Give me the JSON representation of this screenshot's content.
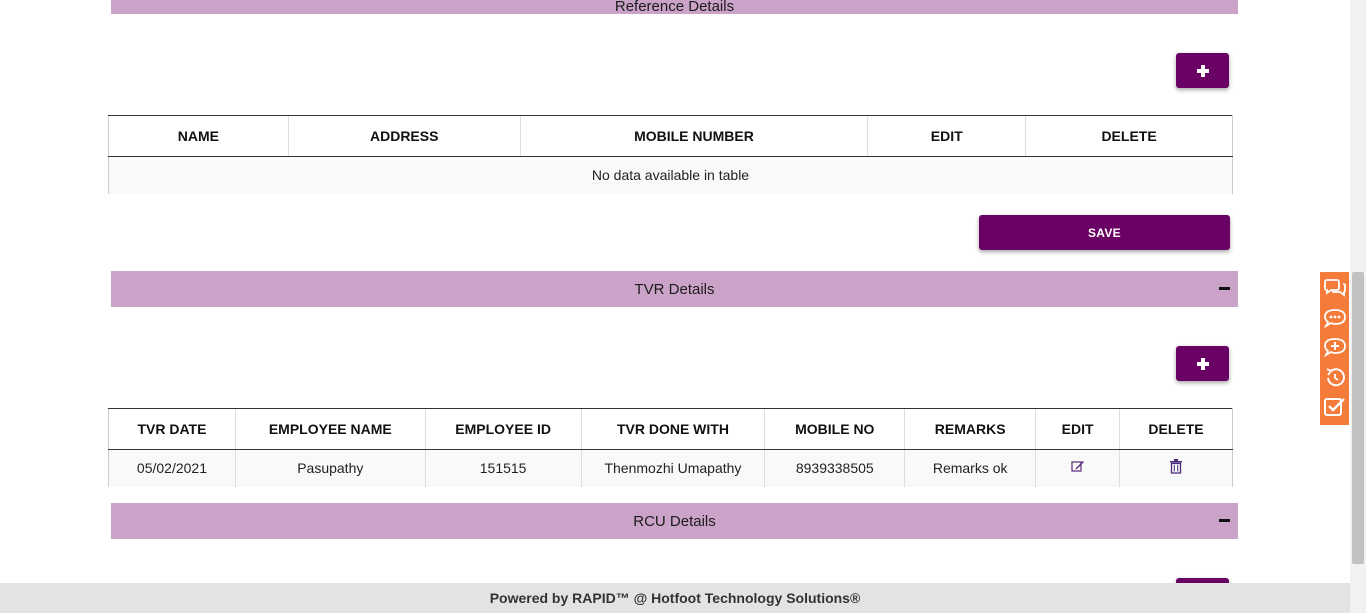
{
  "reference_section": {
    "title": "Reference Details",
    "columns": [
      "NAME",
      "ADDRESS",
      "MOBILE NUMBER",
      "EDIT",
      "DELETE"
    ],
    "empty_message": "No data available in table",
    "save_label": "SAVE"
  },
  "tvr_section": {
    "title": "TVR Details",
    "columns": [
      "TVR DATE",
      "EMPLOYEE NAME",
      "EMPLOYEE ID",
      "TVR DONE WITH",
      "MOBILE NO",
      "REMARKS",
      "EDIT",
      "DELETE"
    ],
    "rows": [
      {
        "tvr_date": "05/02/2021",
        "employee_name": "Pasupathy",
        "employee_id": "151515",
        "tvr_done_with": "Thenmozhi Umapathy",
        "mobile_no": "8939338505",
        "remarks": "Remarks ok"
      }
    ]
  },
  "rcu_section": {
    "title": "RCU Details"
  },
  "footer": {
    "text": "Powered by RAPID™ @ Hotfoot Technology Solutions®"
  },
  "side_toolbar": {
    "icons": [
      "comments-icon",
      "chat-bubble-icon",
      "add-comment-icon",
      "history-icon",
      "checklist-icon"
    ]
  },
  "colors": {
    "primary": "#6a0164",
    "section_header": "#cba3c8",
    "toolbar": "#f47b3a",
    "footer_bg": "#e3e3e3"
  }
}
